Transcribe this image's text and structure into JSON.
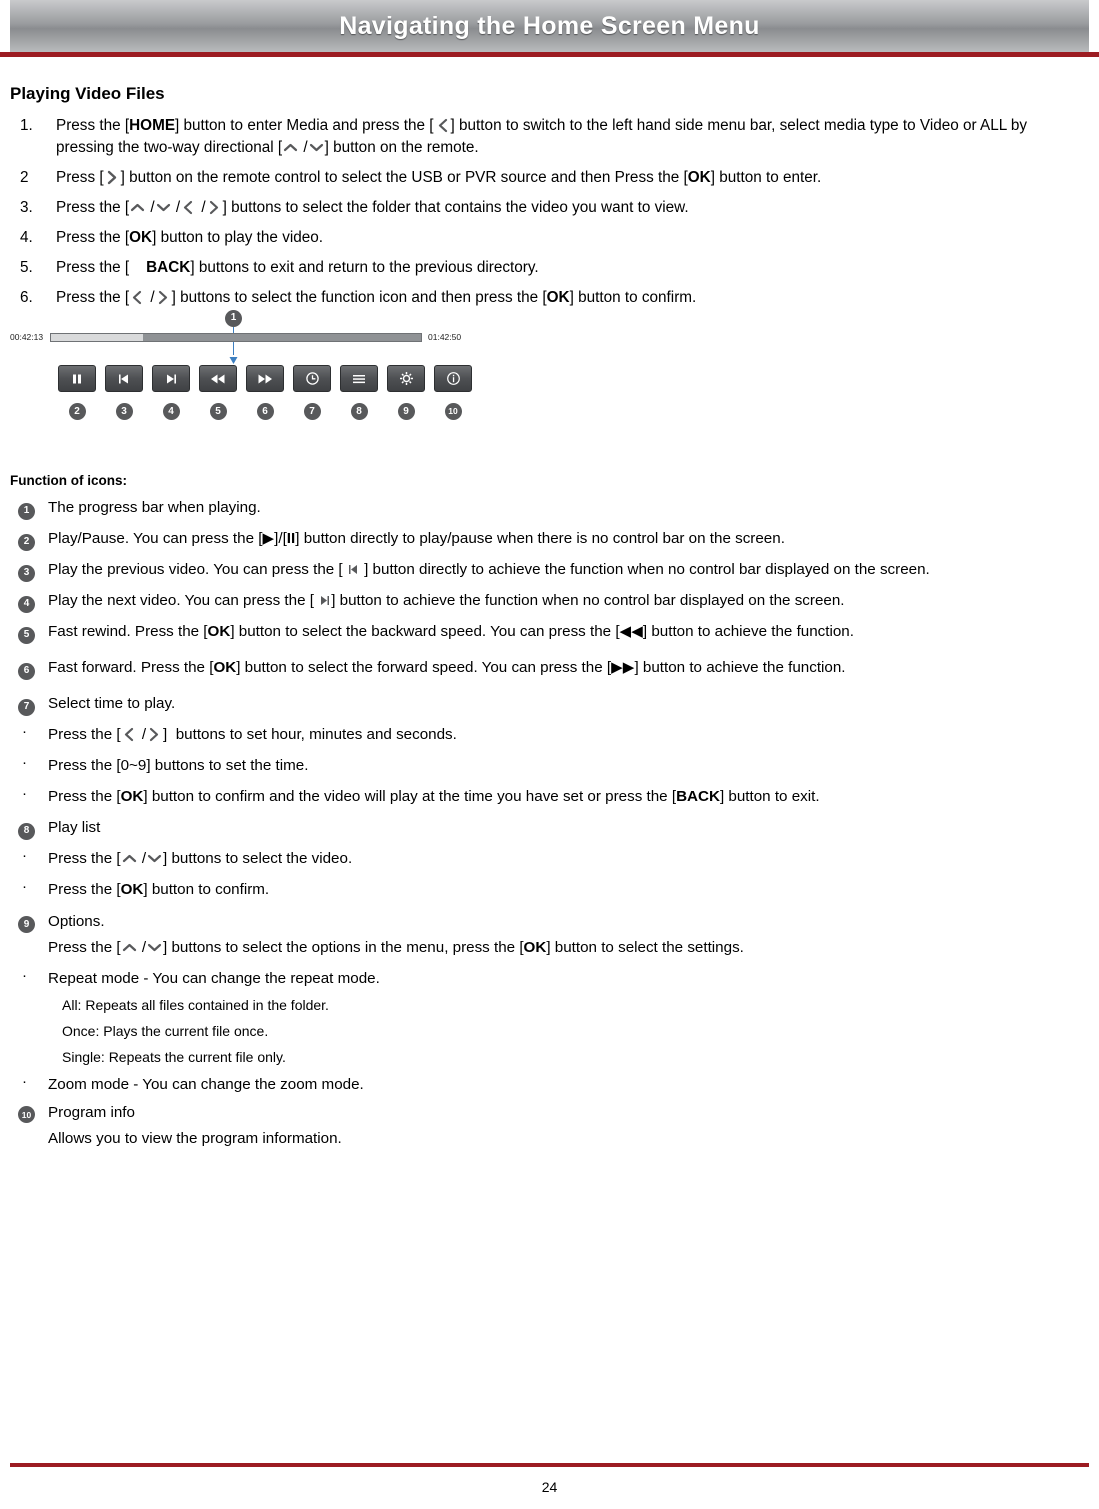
{
  "header": {
    "title": "Navigating the Home Screen Menu",
    "rule_color": "#9c1c22"
  },
  "section": {
    "title": "Playing Video Files"
  },
  "steps": [
    {
      "num": "1.",
      "parts": [
        "Press the [",
        "HOME",
        "] button to enter Media and press the [",
        "‹",
        "] button to switch to the left hand side menu bar, select media type to Video or ALL by pressing the two-way directional [",
        "˄ / ˅",
        "] button on the remote."
      ]
    },
    {
      "num": "2",
      "text": "Press [ ] button on the remote control to select the USB or PVR source and then Press the [OK] button to enter."
    },
    {
      "num": "3.",
      "text": "Press the [ / / / ] buttons to select the folder that contains the video you want to view."
    },
    {
      "num": "4.",
      "text": "Press the [OK] button to play the video."
    },
    {
      "num": "5.",
      "text": "Press the [ BACK] buttons to exit and return to the previous directory."
    },
    {
      "num": "6.",
      "text": "Press the [ / ] buttons to select the function icon and then press the [OK] button to confirm."
    }
  ],
  "step_labels": {
    "home": "HOME",
    "ok": "OK",
    "back": "BACK"
  },
  "player": {
    "time_elapsed": "00:42:13",
    "time_total": "01:42:50",
    "progress_percent": 25,
    "buttons": [
      {
        "name": "pause-button",
        "glyph": "pause"
      },
      {
        "name": "previous-button",
        "glyph": "prev"
      },
      {
        "name": "next-button",
        "glyph": "next"
      },
      {
        "name": "rewind-button",
        "glyph": "rew"
      },
      {
        "name": "forward-button",
        "glyph": "fwd"
      },
      {
        "name": "time-select-button",
        "glyph": "clock"
      },
      {
        "name": "playlist-button",
        "glyph": "list"
      },
      {
        "name": "options-button",
        "glyph": "gear"
      },
      {
        "name": "program-info-button",
        "glyph": "info"
      }
    ],
    "callouts": [
      "1",
      "2",
      "3",
      "4",
      "5",
      "6",
      "7",
      "8",
      "9",
      "10"
    ]
  },
  "functions_title": "Function of icons:",
  "items": [
    {
      "badge": "1",
      "text": "The progress bar when playing."
    },
    {
      "badge": "2",
      "text": "Play/Pause. You can press the [▶]/[II] button directly to play/pause when there is no control bar on the screen."
    },
    {
      "badge": "3",
      "text": "Play the previous video. You can press the [ ◀ ] button directly to achieve the function when no control bar displayed on the screen."
    },
    {
      "badge": "4",
      "text": "Play the next video. You can press the [ ▶ ] button to achieve the function when no control bar displayed on the screen."
    },
    {
      "badge": "5",
      "text": "Fast rewind. Press the [OK] button to select the backward speed. You can press the [◀◀] button to achieve the function."
    },
    {
      "badge": "6",
      "text": "Fast forward. Press the [OK] button to select the forward speed. You can press the [▶▶] button to achieve the function."
    },
    {
      "badge": "7",
      "text": "Select time to play."
    },
    {
      "badge": "8",
      "text": "Play list"
    },
    {
      "badge": "9",
      "text": "Options."
    },
    {
      "badge": "10",
      "text": "Program info"
    }
  ],
  "bullets": {
    "b7_1": "Press the [ / ]  buttons to set hour, minutes and seconds.",
    "b7_2": "Press the [0~9] buttons to set the time.",
    "b7_3": "Press the [OK] button to confirm and the video will play at the time you have set or press the [BACK] button to exit.",
    "b8_1": "Press the [ / ] buttons to select the video.",
    "b8_2": "Press the [OK] button to confirm.",
    "b9_line": "Press the [ / ] buttons to select the options in the menu, press the [OK] button to select the settings.",
    "b9_repeat": "Repeat mode - You can change the repeat mode.",
    "b9_all": "All: Repeats all files contained in the folder.",
    "b9_once": "Once: Plays the current file once.",
    "b9_single": "Single: Repeats the current file only.",
    "b9_zoom": "Zoom mode - You can change the zoom mode.",
    "b10_line": "Allows you to view the program information."
  },
  "footer": {
    "page": "24"
  }
}
